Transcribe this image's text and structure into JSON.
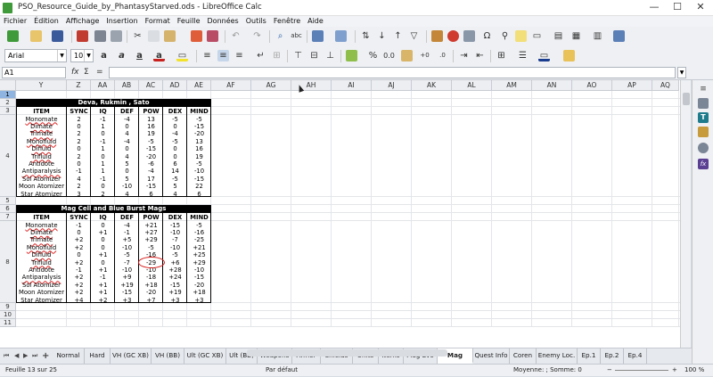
{
  "window": {
    "title": "PSO_Resource_Guide_by_PhantasyStarved.ods - LibreOffice Calc",
    "min": "—",
    "max": "☐",
    "close": "✕"
  },
  "menu": [
    "Fichier",
    "Édition",
    "Affichage",
    "Insertion",
    "Format",
    "Feuille",
    "Données",
    "Outils",
    "Fenêtre",
    "Aide"
  ],
  "font": {
    "name": "Arial",
    "size": "10"
  },
  "formula": {
    "cell_ref": "A1",
    "fx": "fx",
    "sum": "Σ",
    "eq": "="
  },
  "columns": [
    "Y",
    "Z",
    "AA",
    "AB",
    "AC",
    "AD",
    "AE",
    "AF",
    "AG",
    "AH",
    "AI",
    "AJ",
    "AK",
    "AL",
    "AM",
    "AN",
    "AO",
    "AP",
    "AQ"
  ],
  "rows": [
    "1",
    "2",
    "3",
    "4",
    "5",
    "6",
    "7",
    "8",
    "9",
    "10",
    "11"
  ],
  "table1": {
    "title": "Deva, Rukmin , Sato",
    "headers": [
      "ITEM",
      "SYNC",
      "IQ",
      "DEF",
      "POW",
      "DEX",
      "MIND"
    ],
    "rows": [
      [
        "Monomate",
        "2",
        "-1",
        "-4",
        "13",
        "-5",
        "-5"
      ],
      [
        "Dimate",
        "0",
        "1",
        "0",
        "16",
        "0",
        "-15"
      ],
      [
        "Trimate",
        "2",
        "0",
        "4",
        "19",
        "-4",
        "-20"
      ],
      [
        "Monofluid",
        "2",
        "-1",
        "-4",
        "-5",
        "-5",
        "13"
      ],
      [
        "Difluid",
        "0",
        "1",
        "0",
        "-15",
        "0",
        "16"
      ],
      [
        "Trifluid",
        "2",
        "0",
        "4",
        "-20",
        "0",
        "19"
      ],
      [
        "Antidote",
        "0",
        "1",
        "5",
        "-6",
        "6",
        "-5"
      ],
      [
        "Antiparalysis",
        "-1",
        "1",
        "0",
        "-4",
        "14",
        "-10"
      ],
      [
        "Sol Atomizer",
        "4",
        "-1",
        "5",
        "17",
        "-5",
        "-15"
      ],
      [
        "Moon Atomizer",
        "2",
        "0",
        "-10",
        "-15",
        "5",
        "22"
      ],
      [
        "Star Atomizer",
        "3",
        "2",
        "4",
        "6",
        "4",
        "6"
      ]
    ]
  },
  "table2": {
    "title": "Mag Cell and Blue Burst Mags",
    "headers": [
      "ITEM",
      "SYNC",
      "IQ",
      "DEF",
      "POW",
      "DEX",
      "MIND"
    ],
    "rows": [
      [
        "Monomate",
        "-1",
        "0",
        "-4",
        "+21",
        "-15",
        "-5"
      ],
      [
        "Dimate",
        "0",
        "+1",
        "-1",
        "+27",
        "-10",
        "-16"
      ],
      [
        "Trimate",
        "+2",
        "0",
        "+5",
        "+29",
        "-7",
        "-25"
      ],
      [
        "Monofluid",
        "+2",
        "0",
        "-10",
        "-5",
        "-10",
        "+21"
      ],
      [
        "Difluid",
        "0",
        "+1",
        "-5",
        "-16",
        "-5",
        "+25"
      ],
      [
        "Trifluid",
        "+2",
        "0",
        "-7",
        "-29",
        "+6",
        "+29"
      ],
      [
        "Antidote",
        "-1",
        "+1",
        "-10",
        "-10",
        "+28",
        "-10"
      ],
      [
        "Antiparalysis",
        "+2",
        "-1",
        "+9",
        "-18",
        "+24",
        "-15"
      ],
      [
        "Sol Atomizer",
        "+2",
        "+1",
        "+19",
        "+18",
        "-15",
        "-20"
      ],
      [
        "Moon Atomizer",
        "+2",
        "+1",
        "-15",
        "-20",
        "+19",
        "+18"
      ],
      [
        "Star Atomizer",
        "+4",
        "+2",
        "+3",
        "+7",
        "+3",
        "+3"
      ]
    ]
  },
  "tabs": [
    "Normal",
    "Hard",
    "VH (GC XB)",
    "VH (BB)",
    "Ult (GC XB)",
    "Ult (BB)",
    "Weapons",
    "Armor",
    "Shields",
    "Units",
    "Items",
    "Mag Evo",
    "Mag Food",
    "Quest Info",
    "Coren",
    "Enemy Loc.",
    "Ep.1",
    "Ep.2",
    "Ep.4"
  ],
  "active_tab": "Mag Food",
  "status": {
    "sheet": "Feuille 13 sur 25",
    "style": "Par défaut",
    "summary": "Moyenne: ; Somme: 0",
    "zoom": "100 %"
  },
  "colors": {
    "selection": "#8fb4df",
    "annotation": "#d51a1a"
  }
}
